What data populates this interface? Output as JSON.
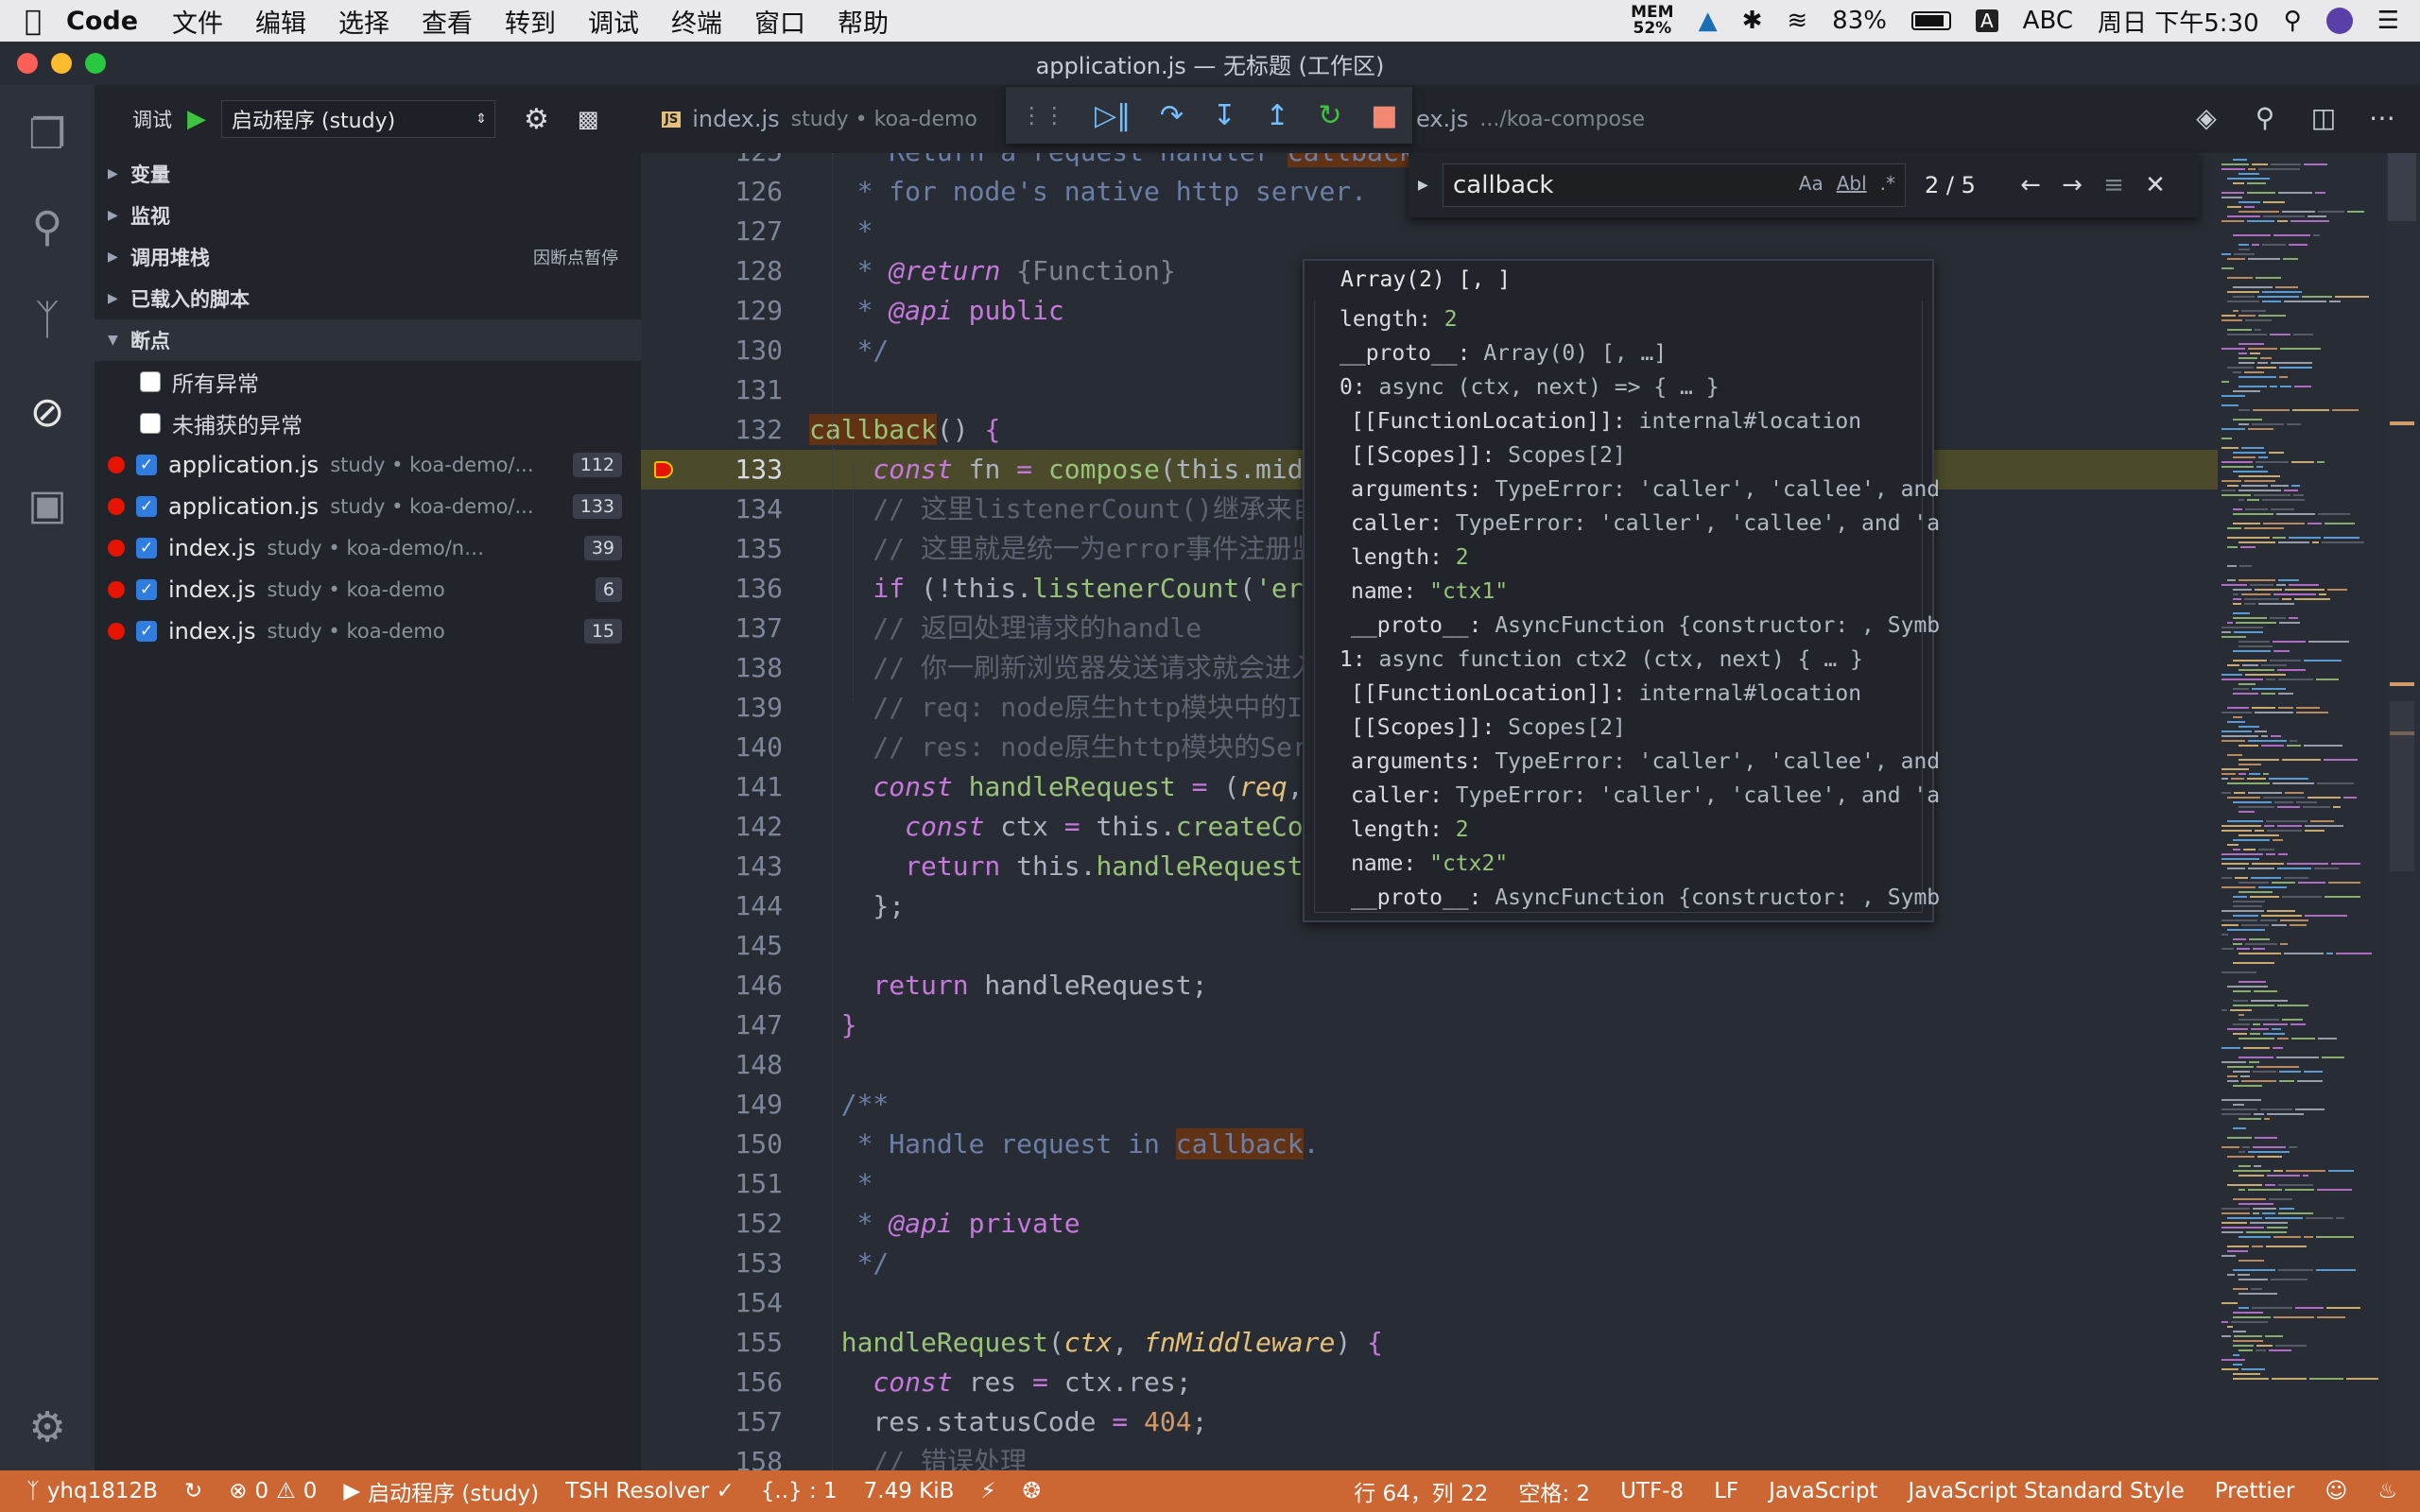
{
  "menubar": {
    "app": "Code",
    "items": [
      "文件",
      "编辑",
      "选择",
      "查看",
      "转到",
      "调试",
      "终端",
      "窗口",
      "帮助"
    ],
    "mem_label": "MEM",
    "mem_value": "52%",
    "battery": "83%",
    "input_method": "ABC",
    "input_badge": "A",
    "clock": "周日 下午5:30"
  },
  "window": {
    "title": "application.js — 无标题 (工作区)"
  },
  "debug": {
    "label": "调试",
    "config": "启动程序 (study)",
    "sections": {
      "variables": "变量",
      "watch": "监视",
      "callstack": "调用堆栈",
      "callstack_hint": "因断点暂停",
      "scripts": "已载入的脚本",
      "breakpoints": "断点"
    },
    "exception_options": [
      "所有异常",
      "未捕获的异常"
    ],
    "breakpoints": [
      {
        "file": "application.js",
        "path": "study • koa-demo/...",
        "line": "112"
      },
      {
        "file": "application.js",
        "path": "study • koa-demo/...",
        "line": "133"
      },
      {
        "file": "index.js",
        "path": "study • koa-demo/node_...",
        "line": "39"
      },
      {
        "file": "index.js",
        "path": "study • koa-demo",
        "line": "6"
      },
      {
        "file": "index.js",
        "path": "study • koa-demo",
        "line": "15"
      }
    ]
  },
  "tabs": [
    {
      "name": "index.js",
      "desc": "study • koa-demo"
    },
    {
      "name": "ex.js",
      "desc": ".../koa-compose"
    }
  ],
  "find": {
    "query": "callback",
    "opt_case": "Aa",
    "opt_word": "Abl",
    "opt_regex": ".*",
    "count": "2 / 5"
  },
  "hover": {
    "header": "Array(2) [, ]",
    "rows": [
      {
        "k": "length: ",
        "v": "2",
        "t": "n",
        "ind": 0,
        "arrow": ""
      },
      {
        "k": "__proto__: ",
        "v": "Array(0) [, …]",
        "t": "v",
        "ind": 0,
        "arrow": "▶"
      },
      {
        "k": "0: ",
        "v": "async (ctx, next) => { … }",
        "t": "v",
        "ind": 0,
        "arrow": "▼"
      },
      {
        "k": "[[FunctionLocation]]: ",
        "v": "internal#location",
        "t": "v",
        "ind": 1,
        "arrow": ""
      },
      {
        "k": "[[Scopes]]: ",
        "v": "Scopes[2]",
        "t": "v",
        "ind": 1,
        "arrow": "▶"
      },
      {
        "k": "arguments: ",
        "v": "TypeError: 'caller', 'callee', and",
        "t": "v",
        "ind": 1,
        "arrow": ""
      },
      {
        "k": "caller: ",
        "v": "TypeError: 'caller', 'callee', and 'a",
        "t": "v",
        "ind": 1,
        "arrow": ""
      },
      {
        "k": "length: ",
        "v": "2",
        "t": "n",
        "ind": 1,
        "arrow": ""
      },
      {
        "k": "name: ",
        "v": "\"ctx1\"",
        "t": "s",
        "ind": 1,
        "arrow": ""
      },
      {
        "k": "__proto__: ",
        "v": "AsyncFunction {constructor: , Symb",
        "t": "v",
        "ind": 1,
        "arrow": "▶"
      },
      {
        "k": "1: ",
        "v": "async function ctx2 (ctx, next) { … }",
        "t": "v",
        "ind": 0,
        "arrow": "▼"
      },
      {
        "k": "[[FunctionLocation]]: ",
        "v": "internal#location",
        "t": "v",
        "ind": 1,
        "arrow": ""
      },
      {
        "k": "[[Scopes]]: ",
        "v": "Scopes[2]",
        "t": "v",
        "ind": 1,
        "arrow": "▶"
      },
      {
        "k": "arguments: ",
        "v": "TypeError: 'caller', 'callee', and",
        "t": "v",
        "ind": 1,
        "arrow": ""
      },
      {
        "k": "caller: ",
        "v": "TypeError: 'caller', 'callee', and 'a",
        "t": "v",
        "ind": 1,
        "arrow": ""
      },
      {
        "k": "length: ",
        "v": "2",
        "t": "n",
        "ind": 1,
        "arrow": ""
      },
      {
        "k": "name: ",
        "v": "\"ctx2\"",
        "t": "s",
        "ind": 1,
        "arrow": ""
      },
      {
        "k": "__proto__: ",
        "v": "AsyncFunction {constructor: , Symb",
        "t": "v",
        "ind": 1,
        "arrow": "▶"
      }
    ]
  },
  "editor": {
    "current_line": "133",
    "lines": [
      {
        "n": "125",
        "t": [
          [
            "cmt",
            "   * Return a request handler "
          ],
          [
            "hl cmt",
            "callback"
          ]
        ]
      },
      {
        "n": "126",
        "t": [
          [
            "cmt",
            "   * for node's native http server."
          ]
        ]
      },
      {
        "n": "127",
        "t": [
          [
            "cmt",
            "   *"
          ]
        ]
      },
      {
        "n": "128",
        "t": [
          [
            "cmt",
            "   * "
          ],
          [
            "tg",
            "@return"
          ],
          [
            "ty",
            " {Function}"
          ]
        ]
      },
      {
        "n": "129",
        "t": [
          [
            "cmt",
            "   * "
          ],
          [
            "tg",
            "@api"
          ],
          [
            "kw",
            " public"
          ]
        ]
      },
      {
        "n": "130",
        "t": [
          [
            "cmt",
            "   */"
          ]
        ]
      },
      {
        "n": "131",
        "t": []
      },
      {
        "n": "132",
        "t": [
          [
            "hl fnd",
            "callback"
          ],
          [
            "",
            "() "
          ],
          [
            "kw",
            "{"
          ]
        ]
      },
      {
        "n": "133",
        "t": [
          [
            "",
            "    "
          ],
          [
            "kw it",
            "const"
          ],
          [
            "",
            " fn "
          ],
          [
            "kw",
            "="
          ],
          [
            "",
            " "
          ],
          [
            "fnd",
            "compose"
          ],
          [
            "",
            "(this.middl"
          ]
        ]
      },
      {
        "n": "134",
        "t": [
          [
            "cm",
            "    // 这里listenerCount()继承来自e"
          ]
        ]
      },
      {
        "n": "135",
        "t": [
          [
            "cm",
            "    // 这里就是统一为error事件注册监听"
          ]
        ]
      },
      {
        "n": "136",
        "t": [
          [
            "kw",
            "    if"
          ],
          [
            "",
            " (!this."
          ],
          [
            "fnd",
            "listenerCount"
          ],
          [
            "",
            "("
          ],
          [
            "st",
            "'erro"
          ]
        ]
      },
      {
        "n": "137",
        "t": [
          [
            "cm",
            "    // 返回处理请求的handle"
          ]
        ]
      },
      {
        "n": "138",
        "t": [
          [
            "cm",
            "    // 你一刷新浏览器发送请求就会进入这"
          ]
        ]
      },
      {
        "n": "139",
        "t": [
          [
            "cm",
            "    // req: node原生http模块中的Inc"
          ]
        ]
      },
      {
        "n": "140",
        "t": [
          [
            "cm",
            "    // res: node原生http模块的Serve"
          ]
        ]
      },
      {
        "n": "141",
        "t": [
          [
            "",
            "    "
          ],
          [
            "kw it",
            "const"
          ],
          [
            "fnd",
            " handleRequest "
          ],
          [
            "kw",
            "="
          ],
          [
            "",
            " ("
          ],
          [
            "yl it",
            "req"
          ],
          [
            "",
            ", "
          ],
          [
            "yl it",
            "r"
          ]
        ]
      },
      {
        "n": "142",
        "t": [
          [
            "",
            "      "
          ],
          [
            "kw it",
            "const"
          ],
          [
            "",
            " ctx "
          ],
          [
            "kw",
            "="
          ],
          [
            "",
            " this."
          ],
          [
            "fnd",
            "createCont"
          ]
        ]
      },
      {
        "n": "143",
        "t": [
          [
            "kw",
            "      return"
          ],
          [
            "",
            " this."
          ],
          [
            "fnd",
            "handleRequest"
          ],
          [
            "",
            "(c"
          ]
        ]
      },
      {
        "n": "144",
        "t": [
          [
            "",
            "    };"
          ]
        ]
      },
      {
        "n": "145",
        "t": []
      },
      {
        "n": "146",
        "t": [
          [
            "kw",
            "    return"
          ],
          [
            "",
            " handleRequest;"
          ]
        ]
      },
      {
        "n": "147",
        "t": [
          [
            "kw",
            "  }"
          ]
        ]
      },
      {
        "n": "148",
        "t": []
      },
      {
        "n": "149",
        "t": [
          [
            "cmt",
            "  /**"
          ]
        ]
      },
      {
        "n": "150",
        "t": [
          [
            "cmt",
            "   * Handle request in "
          ],
          [
            "hl cmt",
            "callback"
          ],
          [
            "cmt",
            "."
          ]
        ]
      },
      {
        "n": "151",
        "t": [
          [
            "cmt",
            "   *"
          ]
        ]
      },
      {
        "n": "152",
        "t": [
          [
            "cmt",
            "   * "
          ],
          [
            "tg",
            "@api"
          ],
          [
            "kw",
            " private"
          ]
        ]
      },
      {
        "n": "153",
        "t": [
          [
            "cmt",
            "   */"
          ]
        ]
      },
      {
        "n": "154",
        "t": []
      },
      {
        "n": "155",
        "t": [
          [
            "fnd",
            "  handleRequest"
          ],
          [
            "",
            "("
          ],
          [
            "yl it",
            "ctx"
          ],
          [
            "",
            ", "
          ],
          [
            "yl it",
            "fnMiddleware"
          ],
          [
            "",
            ") "
          ],
          [
            "kw",
            "{"
          ]
        ]
      },
      {
        "n": "156",
        "t": [
          [
            "",
            "    "
          ],
          [
            "kw it",
            "const"
          ],
          [
            "",
            " res "
          ],
          [
            "kw",
            "="
          ],
          [
            "",
            " ctx.res;"
          ]
        ]
      },
      {
        "n": "157",
        "t": [
          [
            "",
            "    res.statusCode "
          ],
          [
            "kw",
            "="
          ],
          [
            "nm",
            " 404"
          ],
          [
            "",
            ";"
          ]
        ]
      },
      {
        "n": "158",
        "t": [
          [
            "cm",
            "    // 错误处理"
          ]
        ]
      }
    ]
  },
  "status": {
    "branch": "yhq1812B",
    "errors": "0",
    "warnings": "0",
    "debug_config": "启动程序 (study)",
    "resolver": "TSH Resolver ✓",
    "braces": "{..} : 1",
    "size": "7.49 KiB",
    "position": "行 64，列 22",
    "spaces": "空格: 2",
    "encoding": "UTF-8",
    "eol": "LF",
    "language": "JavaScript",
    "style": "JavaScript Standard Style",
    "formatter": "Prettier"
  },
  "colors": {
    "status_bar": "#cc6633",
    "breakpoint": "#e51400",
    "accent_green": "#98c379"
  }
}
